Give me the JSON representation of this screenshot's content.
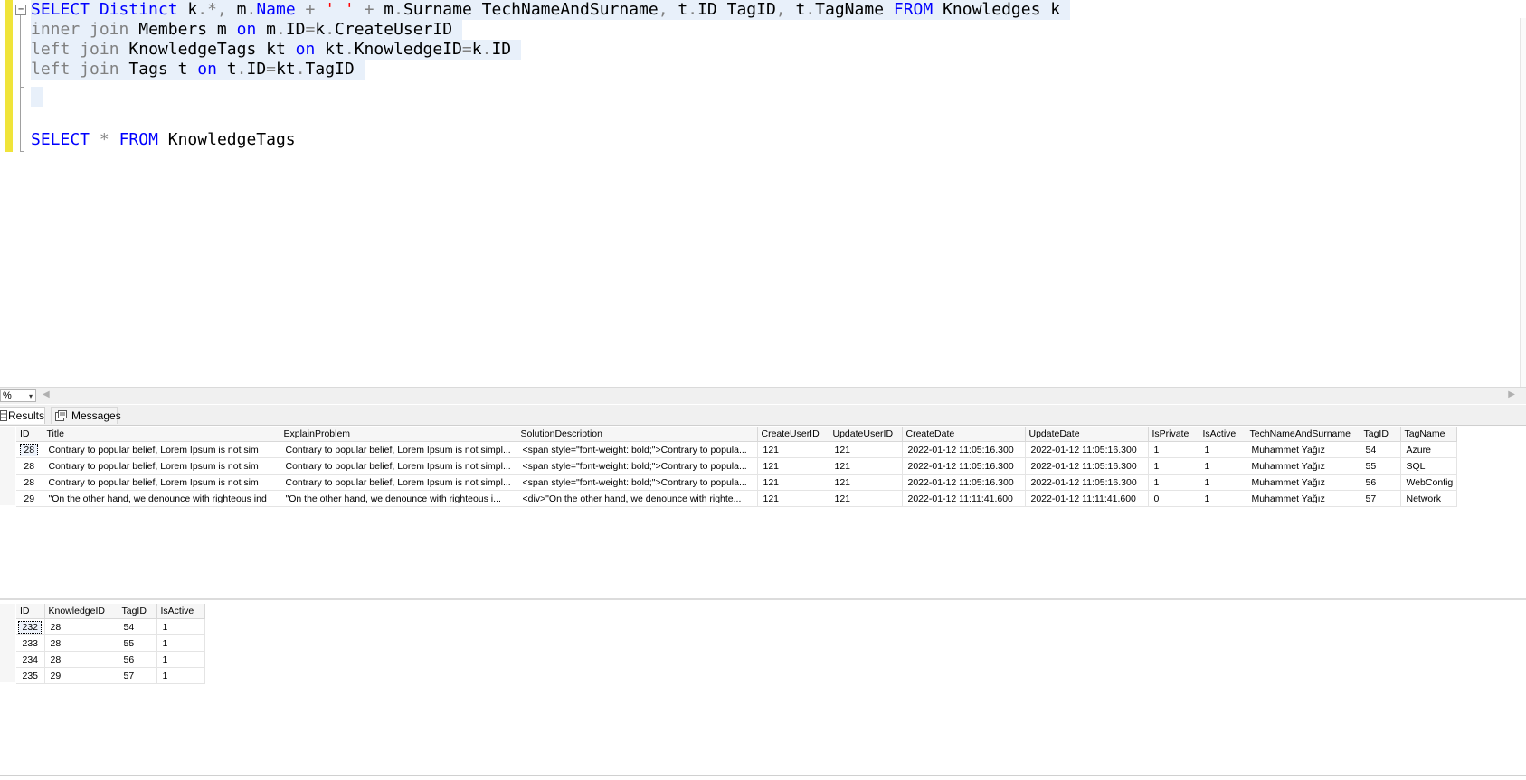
{
  "editor": {
    "fold_symbol": "−",
    "lines": [
      {
        "selected": true,
        "tokens": [
          {
            "t": "SELECT",
            "c": "kw"
          },
          {
            "t": " "
          },
          {
            "t": "Distinct",
            "c": "kw"
          },
          {
            "t": " k"
          },
          {
            "t": ".",
            "c": "op"
          },
          {
            "t": "*",
            "c": "op"
          },
          {
            "t": ",",
            "c": "op"
          },
          {
            "t": " m"
          },
          {
            "t": ".",
            "c": "op"
          },
          {
            "t": "Name",
            "c": "kw"
          },
          {
            "t": " "
          },
          {
            "t": "+",
            "c": "op"
          },
          {
            "t": " "
          },
          {
            "t": "' '",
            "c": "st"
          },
          {
            "t": " "
          },
          {
            "t": "+",
            "c": "op"
          },
          {
            "t": " m"
          },
          {
            "t": ".",
            "c": "op"
          },
          {
            "t": "Surname TechNameAndSurname"
          },
          {
            "t": ",",
            "c": "op"
          },
          {
            "t": " t"
          },
          {
            "t": ".",
            "c": "op"
          },
          {
            "t": "ID TagID"
          },
          {
            "t": ",",
            "c": "op"
          },
          {
            "t": " t"
          },
          {
            "t": ".",
            "c": "op"
          },
          {
            "t": "TagName "
          },
          {
            "t": "FROM",
            "c": "kw"
          },
          {
            "t": " Knowledges k "
          }
        ]
      },
      {
        "selected": true,
        "tokens": [
          {
            "t": "inner",
            "c": "gk"
          },
          {
            "t": " "
          },
          {
            "t": "join",
            "c": "gk"
          },
          {
            "t": " Members m "
          },
          {
            "t": "on",
            "c": "kw"
          },
          {
            "t": " m"
          },
          {
            "t": ".",
            "c": "op"
          },
          {
            "t": "ID"
          },
          {
            "t": "=",
            "c": "op"
          },
          {
            "t": "k"
          },
          {
            "t": ".",
            "c": "op"
          },
          {
            "t": "CreateUserID "
          }
        ]
      },
      {
        "selected": true,
        "tokens": [
          {
            "t": "left",
            "c": "gk"
          },
          {
            "t": " "
          },
          {
            "t": "join",
            "c": "gk"
          },
          {
            "t": " KnowledgeTags kt "
          },
          {
            "t": "on",
            "c": "kw"
          },
          {
            "t": " kt"
          },
          {
            "t": ".",
            "c": "op"
          },
          {
            "t": "KnowledgeID"
          },
          {
            "t": "=",
            "c": "op"
          },
          {
            "t": "k"
          },
          {
            "t": ".",
            "c": "op"
          },
          {
            "t": "ID "
          }
        ]
      },
      {
        "selected": true,
        "tokens": [
          {
            "t": "left",
            "c": "gk"
          },
          {
            "t": " "
          },
          {
            "t": "join",
            "c": "gk"
          },
          {
            "t": " Tags t "
          },
          {
            "t": "on",
            "c": "kw"
          },
          {
            "t": " t"
          },
          {
            "t": ".",
            "c": "op"
          },
          {
            "t": "ID"
          },
          {
            "t": "=",
            "c": "op"
          },
          {
            "t": "kt"
          },
          {
            "t": ".",
            "c": "op"
          },
          {
            "t": "TagID "
          }
        ]
      },
      {
        "selected": true,
        "tokens": []
      },
      {
        "selected": false,
        "tokens": []
      },
      {
        "selected": false,
        "tokens": [
          {
            "t": "SELECT",
            "c": "kw"
          },
          {
            "t": " "
          },
          {
            "t": "*",
            "c": "op"
          },
          {
            "t": " "
          },
          {
            "t": "FROM",
            "c": "kw"
          },
          {
            "t": " KnowledgeTags"
          }
        ]
      }
    ]
  },
  "zoom": {
    "value": "%",
    "dropdown_arrow": "▾",
    "scroll_left": "◀",
    "scroll_right": "▶"
  },
  "tabs": {
    "results_label": "Results",
    "messages_label": "Messages"
  },
  "grid1": {
    "columns": [
      "ID",
      "Title",
      "ExplainProblem",
      "SolutionDescription",
      "CreateUserID",
      "UpdateUserID",
      "CreateDate",
      "UpdateDate",
      "IsPrivate",
      "IsActive",
      "TechNameAndSurname",
      "TagID",
      "TagName"
    ],
    "rows": [
      [
        "28",
        "Contrary to popular belief, Lorem Ipsum is not sim",
        "Contrary to popular belief, Lorem Ipsum is not simpl...",
        "<span style=\"font-weight: bold;\">Contrary to popula...",
        "121",
        "121",
        "2022-01-12 11:05:16.300",
        "2022-01-12 11:05:16.300",
        "1",
        "1",
        "Muhammet Yağız",
        "54",
        "Azure"
      ],
      [
        "28",
        "Contrary to popular belief, Lorem Ipsum is not sim",
        "Contrary to popular belief, Lorem Ipsum is not simpl...",
        "<span style=\"font-weight: bold;\">Contrary to popula...",
        "121",
        "121",
        "2022-01-12 11:05:16.300",
        "2022-01-12 11:05:16.300",
        "1",
        "1",
        "Muhammet Yağız",
        "55",
        "SQL"
      ],
      [
        "28",
        "Contrary to popular belief, Lorem Ipsum is not sim",
        "Contrary to popular belief, Lorem Ipsum is not simpl...",
        "<span style=\"font-weight: bold;\">Contrary to popula...",
        "121",
        "121",
        "2022-01-12 11:05:16.300",
        "2022-01-12 11:05:16.300",
        "1",
        "1",
        "Muhammet Yağız",
        "56",
        "WebConfig"
      ],
      [
        "29",
        "\"On the other hand, we denounce with righteous ind",
        "\"On the other hand, we denounce with righteous i...",
        "<div>\"On the other hand, we denounce with righte...",
        "121",
        "121",
        "2022-01-12 11:11:41.600",
        "2022-01-12 11:11:41.600",
        "0",
        "1",
        "Muhammet Yağız",
        "57",
        "Network"
      ]
    ]
  },
  "grid2": {
    "columns": [
      "ID",
      "KnowledgeID",
      "TagID",
      "IsActive"
    ],
    "rows": [
      [
        "232",
        "28",
        "54",
        "1"
      ],
      [
        "233",
        "28",
        "55",
        "1"
      ],
      [
        "234",
        "28",
        "56",
        "1"
      ],
      [
        "235",
        "29",
        "57",
        "1"
      ]
    ]
  }
}
